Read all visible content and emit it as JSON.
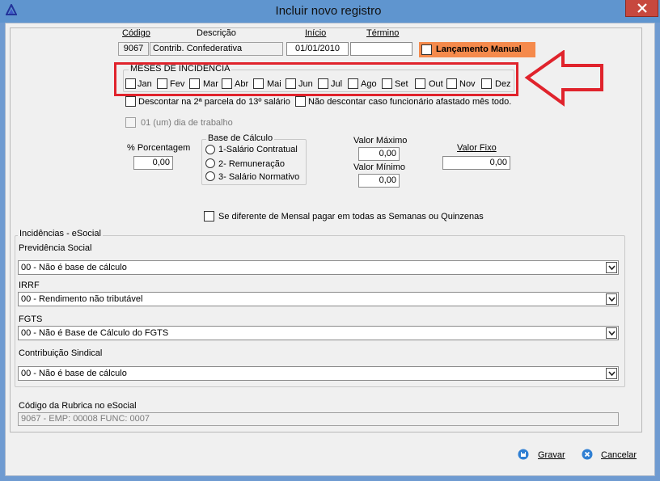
{
  "window": {
    "title": "Incluir novo registro"
  },
  "header": {
    "codigo_label": "Código",
    "descricao_label": "Descrição",
    "inicio_label": "Início",
    "termino_label": "Término",
    "codigo_value": "9067",
    "descricao_value": "Contrib. Confederativa",
    "inicio_value": "01/01/2010",
    "termino_value": "",
    "lancamento_manual_label": "Lançamento Manual",
    "lancamento_color": "#f58a4c"
  },
  "meses": {
    "title": "MESES DE INCIDÊNCIA",
    "months": [
      "Jan",
      "Fev",
      "Mar",
      "Abr",
      "Mai",
      "Jun",
      "Jul",
      "Ago",
      "Set",
      "Out",
      "Nov",
      "Dez"
    ]
  },
  "options": {
    "descontar_2a_parcela": "Descontar na 2ª parcela do 13º salário",
    "nao_descontar_afastado": "Não descontar caso funcionário afastado mês todo.",
    "um_dia_trabalho": "01 (um) dia de trabalho"
  },
  "porcentagem": {
    "label": "% Porcentagem",
    "value": "0,00"
  },
  "base_calculo": {
    "title": "Base de Cálculo",
    "options": [
      "1-Salário Contratual",
      "2- Remuneração",
      "3- Salário Normativo"
    ]
  },
  "valores": {
    "maximo_label": "Valor Máximo",
    "maximo_value": "0,00",
    "minimo_label": "Valor Mínimo",
    "minimo_value": "0,00",
    "fixo_label": "Valor Fixo",
    "fixo_value": "0,00"
  },
  "semanas_label": "Se diferente de Mensal pagar em todas as Semanas ou Quinzenas",
  "esocial": {
    "title": "Incidências - eSocial",
    "previdencia_label": "Previdência Social",
    "previdencia_value": "00 - Não é base de cálculo",
    "irrf_label": "IRRF",
    "irrf_value": "00 - Rendimento não tributável",
    "fgts_label": "FGTS",
    "fgts_value": "00 - Não é Base de Cálculo do FGTS",
    "sindical_label": "Contribuição Sindical",
    "sindical_value": "00 - Não é base de cálculo"
  },
  "rubrica": {
    "label": "Código da Rubrica no eSocial",
    "value": "9067 - EMP: 00008 FUNC: 0007"
  },
  "footer": {
    "gravar_label": "Gravar",
    "cancelar_label": "Cancelar"
  },
  "colors": {
    "highlight": "#e0232c",
    "titlebar": "#5f95cf"
  }
}
